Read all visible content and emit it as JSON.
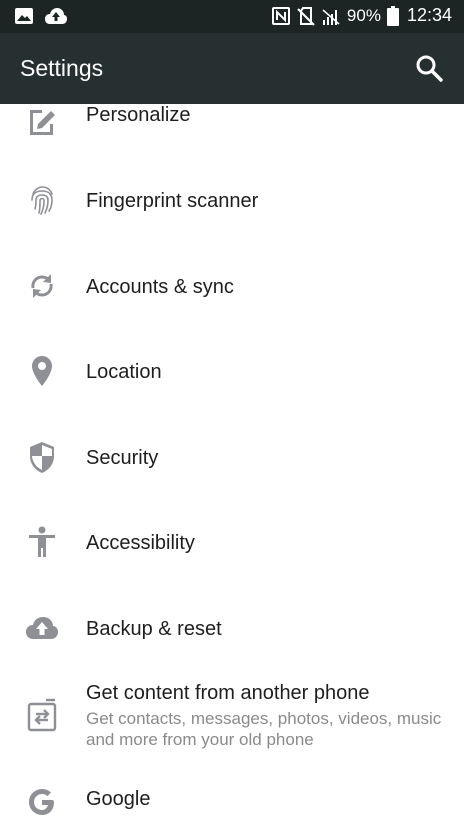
{
  "status_bar": {
    "battery": "90%",
    "time": "12:34"
  },
  "app_bar": {
    "title": "Settings"
  },
  "settings": {
    "items": [
      {
        "label": "Personalize",
        "icon": "personalize-icon"
      },
      {
        "label": "Fingerprint scanner",
        "icon": "fingerprint-icon"
      },
      {
        "label": "Accounts & sync",
        "icon": "sync-icon"
      },
      {
        "label": "Location",
        "icon": "location-pin-icon"
      },
      {
        "label": "Security",
        "icon": "shield-icon"
      },
      {
        "label": "Accessibility",
        "icon": "accessibility-icon"
      },
      {
        "label": "Backup & reset",
        "icon": "cloud-upload-icon"
      },
      {
        "label": "Get content from another phone",
        "sublabel": "Get contacts, messages, photos, videos, music and more from your old phone",
        "icon": "transfer-icon"
      },
      {
        "label": "Google",
        "icon": "google-icon"
      }
    ]
  },
  "colors": {
    "status_bar_bg": "#1c2424",
    "app_bar_bg": "#263030",
    "icon_gray": "#8e9096",
    "text_primary": "#1e1e1e",
    "text_secondary": "#8a8a8a"
  }
}
